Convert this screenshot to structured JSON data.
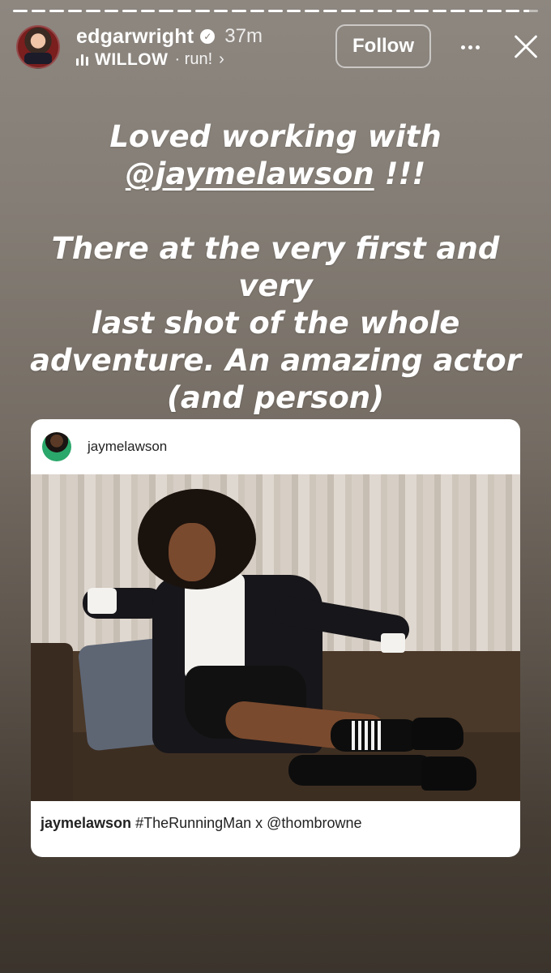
{
  "story": {
    "progress_segments": [
      1,
      1,
      1,
      1,
      1,
      1,
      1,
      1,
      1,
      1,
      1,
      1,
      1,
      1,
      1,
      1,
      1,
      1,
      1,
      1,
      1,
      1,
      1,
      1,
      1,
      1,
      1,
      1,
      0.4
    ]
  },
  "header": {
    "username": "edgarwright",
    "time": "37m",
    "music_title": "WILLOW",
    "music_sub": "· run!",
    "chevron": "›",
    "follow_label": "Follow"
  },
  "caption": {
    "line1": "Loved working with",
    "mention": "@jaymelawson",
    "mention_suffix": " !!!",
    "paragraph": [
      "There at the very first and very",
      "last shot of the whole",
      "adventure. An amazing actor",
      "(and person)"
    ]
  },
  "post": {
    "username": "jaymelawson",
    "caption_user": "jaymelawson",
    "caption_text": " #TheRunningMan x @thombrowne"
  },
  "icons": {
    "verified": "verified-badge-icon",
    "music": "music-bars-icon",
    "more": "more-dots-icon",
    "close": "close-icon"
  },
  "colors": {
    "background_top": "#8d8780",
    "background_bottom": "#3b342c",
    "text": "#ffffff",
    "card": "#ffffff"
  }
}
